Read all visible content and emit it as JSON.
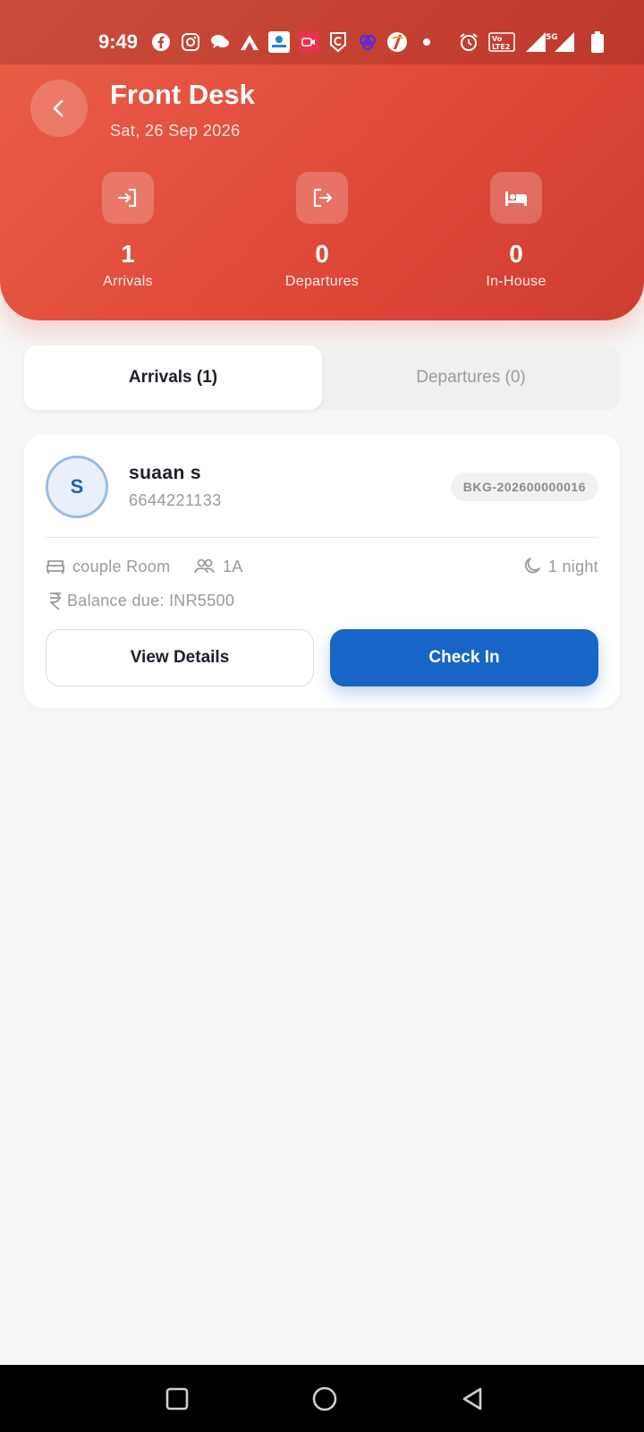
{
  "status_bar": {
    "time": "9:49",
    "icons": [
      "facebook-icon",
      "instagram-icon",
      "chat-icon",
      "axis-icon",
      "sbi-card-icon",
      "video-icon",
      "shield-icon",
      "link-icon",
      "app-icon",
      "dot-icon",
      "alarm-icon",
      "volte-icon",
      "signal-icon",
      "battery-icon"
    ],
    "network": "5G"
  },
  "header": {
    "title": "Front Desk",
    "date": "Sat, 26 Sep 2026",
    "stats": [
      {
        "icon": "login-icon",
        "value": "1",
        "label": "Arrivals"
      },
      {
        "icon": "logout-icon",
        "value": "0",
        "label": "Departures"
      },
      {
        "icon": "bed-icon",
        "value": "0",
        "label": "In-House"
      }
    ]
  },
  "tabs": [
    {
      "label": "Arrivals (1)",
      "active": true
    },
    {
      "label": "Departures (0)",
      "active": false
    }
  ],
  "booking": {
    "initial": "S",
    "guest_name": "suaan s",
    "phone": "6644221133",
    "booking_id": "BKG-202600000016",
    "room_type": "couple Room",
    "guests": "1A",
    "nights": "1 night",
    "balance": "Balance due: INR5500",
    "view_details_label": "View Details",
    "check_in_label": "Check In"
  },
  "colors": {
    "header_red": "#e04a3a",
    "primary_blue": "#1766c7",
    "background": "#f7f7f7"
  }
}
